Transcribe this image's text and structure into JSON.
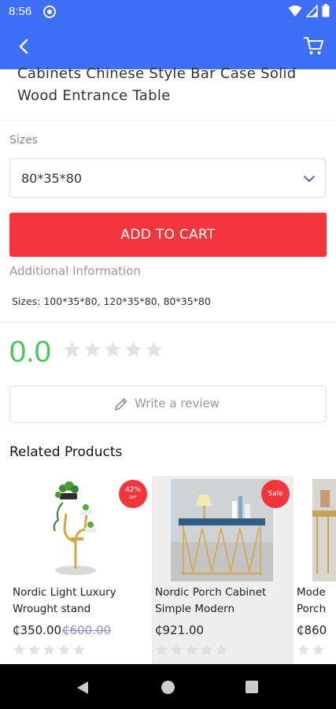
{
  "status_bar": {
    "time": "8:56"
  },
  "product": {
    "title_line1": "Cabinets Chinese Style Bar Case Solid",
    "title_line2": "Wood Entrance Table",
    "sizes_label": "Sizes",
    "selected_size": "80*35*80",
    "add_to_cart_label": "ADD TO CART",
    "additional_info_label": "Additional Information",
    "sizes_info": "Sizes: 100*35*80, 120*35*80, 80*35*80"
  },
  "rating": {
    "value": "0.0",
    "stars_filled": 0,
    "stars_total": 5
  },
  "review": {
    "write_label": "Write a review"
  },
  "related": {
    "title": "Related Products",
    "items": [
      {
        "name_line1": "Nordic Light Luxury",
        "name_line2": "Wrought stand",
        "price": "₵350.00",
        "old_price": "₵600.00",
        "badge_top": "42%",
        "badge_bottom": "OFF",
        "stars_filled": 0
      },
      {
        "name_line1": "Nordic Porch Cabinet",
        "name_line2": "Simple Modern",
        "price": "₵921.00",
        "badge": "Sale",
        "stars_filled": 0
      },
      {
        "name_line1": "Mode",
        "name_line2": "Porch",
        "price": "₵860",
        "stars_filled": 0
      }
    ]
  },
  "colors": {
    "primary": "#3d6ef5",
    "accent": "#f2363b",
    "rating": "#4cc35b",
    "star_empty": "#e3e3e3"
  }
}
